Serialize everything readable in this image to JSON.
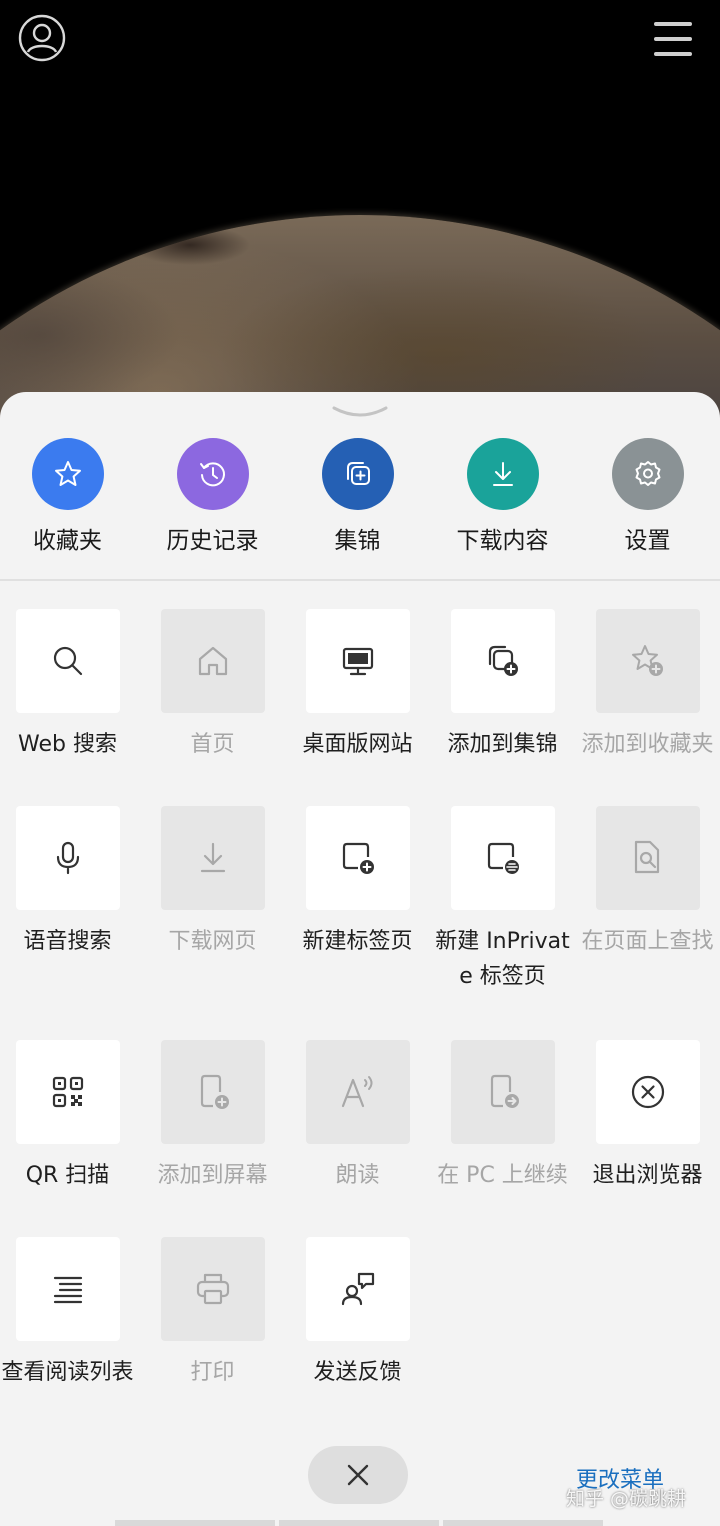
{
  "colors": {
    "favorites": "#3b7bef",
    "history": "#8c68e0",
    "collections": "#2560b4",
    "downloads": "#1aa39a",
    "settings": "#8a9295",
    "link": "#1a6fbf"
  },
  "header": {
    "profile_icon": "profile-icon",
    "menu_icon": "hamburger-menu-icon"
  },
  "quick_actions": [
    {
      "label": "收藏夹",
      "icon": "star-icon"
    },
    {
      "label": "历史记录",
      "icon": "history-icon"
    },
    {
      "label": "集锦",
      "icon": "collections-icon"
    },
    {
      "label": "下载内容",
      "icon": "download-icon"
    },
    {
      "label": "设置",
      "icon": "gear-icon"
    }
  ],
  "grid": [
    {
      "label": "Web 搜索",
      "icon": "search-icon",
      "enabled": true
    },
    {
      "label": "首页",
      "icon": "home-icon",
      "enabled": false
    },
    {
      "label": "桌面版网站",
      "icon": "desktop-icon",
      "enabled": true
    },
    {
      "label": "添加到集锦",
      "icon": "add-to-collection-icon",
      "enabled": true
    },
    {
      "label": "添加到收藏夹",
      "icon": "add-favorite-icon",
      "enabled": false
    },
    {
      "label": "语音搜索",
      "icon": "microphone-icon",
      "enabled": true
    },
    {
      "label": "下载网页",
      "icon": "download-page-icon",
      "enabled": false
    },
    {
      "label": "新建标签页",
      "icon": "new-tab-icon",
      "enabled": true
    },
    {
      "label": "新建 InPrivate 标签页",
      "icon": "inprivate-tab-icon",
      "enabled": true
    },
    {
      "label": "在页面上查找",
      "icon": "find-in-page-icon",
      "enabled": false
    },
    {
      "label": "QR 扫描",
      "icon": "qr-code-icon",
      "enabled": true
    },
    {
      "label": "添加到屏幕",
      "icon": "add-to-home-screen-icon",
      "enabled": false
    },
    {
      "label": "朗读",
      "icon": "read-aloud-icon",
      "enabled": false
    },
    {
      "label": "在 PC 上继续",
      "icon": "continue-on-pc-icon",
      "enabled": false
    },
    {
      "label": "退出浏览器",
      "icon": "exit-icon",
      "enabled": true
    },
    {
      "label": "查看阅读列表",
      "icon": "reading-list-icon",
      "enabled": true
    },
    {
      "label": "打印",
      "icon": "print-icon",
      "enabled": false
    },
    {
      "label": "发送反馈",
      "icon": "feedback-icon",
      "enabled": true
    }
  ],
  "footer": {
    "close_icon": "close-icon",
    "change_menu": "更改菜单",
    "watermark": "知乎 @碳跳耕"
  }
}
